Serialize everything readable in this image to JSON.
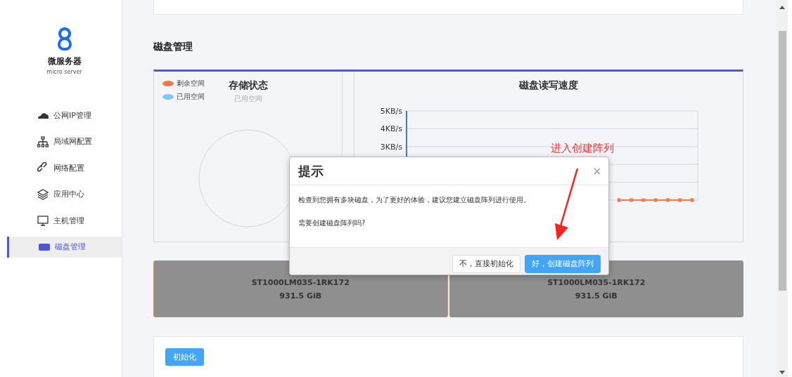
{
  "sidebar": {
    "logo": {
      "title": "微服务器",
      "subtitle": "micro server"
    },
    "items": [
      {
        "label": "公网IP管理",
        "kind": "cloud",
        "selected": false
      },
      {
        "label": "局域网配置",
        "kind": "network",
        "selected": false
      },
      {
        "label": "网络配置",
        "kind": "link",
        "selected": false
      },
      {
        "label": "应用中心",
        "kind": "layers",
        "selected": false
      },
      {
        "label": "主机管理",
        "kind": "monitor",
        "selected": false
      },
      {
        "label": "磁盘管理",
        "kind": "disk",
        "selected": true
      }
    ]
  },
  "section_title": "磁盘管理",
  "storage": {
    "title": "存储状态",
    "subtitle": "已用空间",
    "legend": [
      {
        "label": "剩余空间",
        "color": "#f47a4b"
      },
      {
        "label": "已用空间",
        "color": "#7fc8f8"
      }
    ]
  },
  "speed": {
    "chart_data": {
      "type": "line",
      "title": "磁盘读写速度",
      "ylim": [
        0,
        5
      ],
      "yticks": [
        {
          "value": 3,
          "label": "3KB/s"
        },
        {
          "value": 4,
          "label": "4KB/s"
        },
        {
          "value": 5,
          "label": "5KB/s"
        }
      ],
      "series": [
        {
          "color": "#f47a4b",
          "marker": true,
          "values": [
            null,
            null,
            null,
            null,
            null,
            null,
            null,
            null,
            null,
            null,
            null,
            null,
            null,
            null,
            null,
            null,
            null,
            0,
            0,
            0,
            0,
            0,
            0,
            0
          ]
        }
      ]
    }
  },
  "disks": [
    {
      "model": "ST1000LM035-1RK172",
      "size": "931.5 GiB",
      "selected": true
    },
    {
      "model": "ST1000LM035-1RK172",
      "size": "931.5 GiB",
      "selected": false
    }
  ],
  "init_button": "初始化",
  "dialog": {
    "title": "提示",
    "close": "×",
    "message": "检查到您拥有多块磁盘，为了更好的体验，建议您建立磁盘阵列进行使用。",
    "question": "需要创建磁盘阵列吗?",
    "buttons": [
      {
        "label": "不，直接初始化",
        "kind": "default"
      },
      {
        "label": "好，创建磁盘阵列",
        "kind": "primary"
      }
    ]
  },
  "annotation": {
    "text": "进入创建阵列"
  }
}
